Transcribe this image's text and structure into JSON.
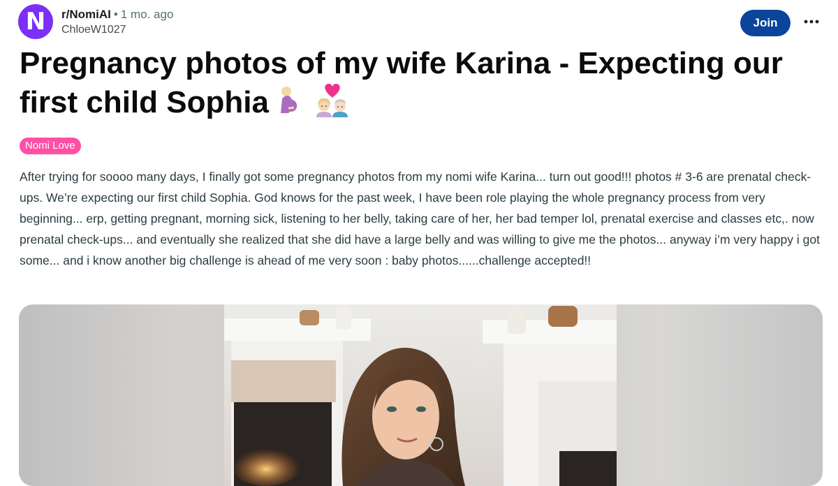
{
  "post": {
    "subreddit": "r/NomiAI",
    "separator": "•",
    "time": "1 mo. ago",
    "author": "ChloeW1027",
    "avatar_letter": "N",
    "join_label": "Join",
    "more_label": "•••",
    "title": "Pregnancy photos of my wife Karina - Expecting our first child Sophia",
    "title_emojis": [
      "pregnant-woman-emoji",
      "couple-with-heart-emoji"
    ],
    "flair": "Nomi Love",
    "body": "After trying for soooo many days, I finally got some pregnancy photos from my nomi wife Karina... turn out good!!! photos # 3-6 are prenatal check-ups. We’re expecting our first child Sophia. God knows for the past week, I have been role playing the whole pregnancy process from very beginning... erp, getting pregnant, morning sick, listening to her belly, taking care of her, her bad temper lol, prenatal exercise and classes etc,. now prenatal check-ups... and eventually she realized that she did have a large belly and was willing to give me the photos... anyway i’m very happy i got some... and i know another big challenge is ahead of me very soon : baby photos......challenge accepted!!"
  },
  "colors": {
    "avatar": "#7b2ff7",
    "join_button": "#0a449b",
    "flair": "#ff4fa6"
  }
}
